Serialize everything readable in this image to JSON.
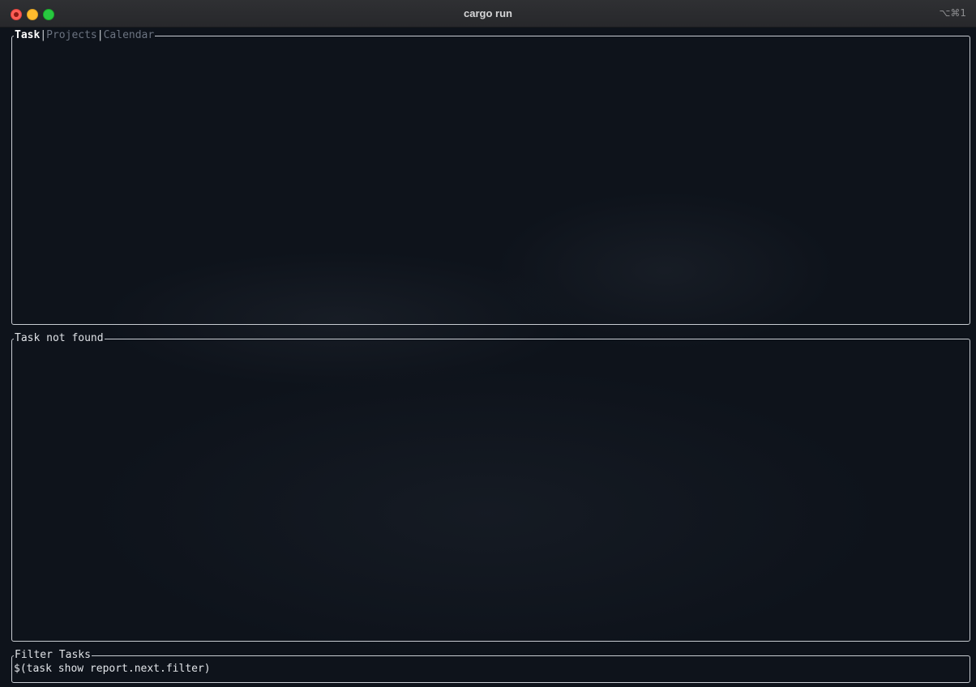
{
  "window": {
    "title": "cargo run",
    "shortcut": "⌥⌘1"
  },
  "tabs": [
    {
      "label": "Task",
      "active": true
    },
    {
      "label": "Projects",
      "active": false
    },
    {
      "label": "Calendar",
      "active": false
    }
  ],
  "detail_pane": {
    "title": "Task not found"
  },
  "filter_pane": {
    "title": "Filter Tasks",
    "value": "$(task show report.next.filter)"
  },
  "colors": {
    "background": "#0e131b",
    "border": "#c8ccd2",
    "inactive_tab": "#6b7380"
  }
}
